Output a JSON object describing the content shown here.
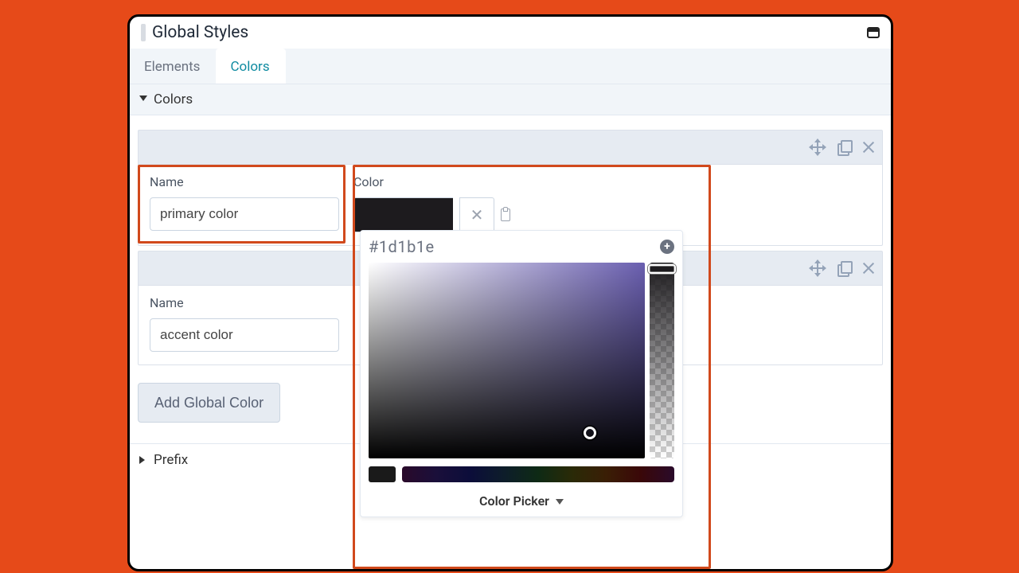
{
  "title": "Global Styles",
  "tabs": {
    "elements": "Elements",
    "colors": "Colors",
    "active": "colors"
  },
  "section_colors": "Colors",
  "section_prefix": "Prefix",
  "labels": {
    "name": "Name",
    "color": "Color"
  },
  "items": [
    {
      "name": "primary color",
      "value": "#1d1b1e"
    },
    {
      "name": "accent color"
    }
  ],
  "add_button": "Add Global Color",
  "picker": {
    "hex": "#1d1b1e",
    "footer": "Color Picker"
  }
}
